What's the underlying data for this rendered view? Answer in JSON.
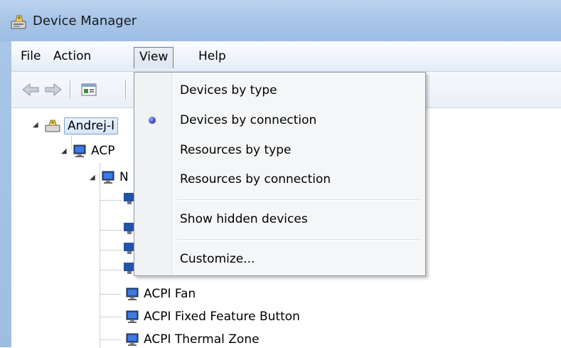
{
  "window": {
    "title": "Device Manager",
    "icon": "device-manager-icon"
  },
  "menubar": {
    "items": [
      {
        "label": "File"
      },
      {
        "label": "Action"
      },
      {
        "label": "View",
        "active": true
      },
      {
        "label": "Help"
      }
    ]
  },
  "toolbar": {
    "buttons": [
      {
        "icon": "back-arrow-icon"
      },
      {
        "icon": "forward-arrow-icon"
      },
      {
        "icon": "properties-icon"
      }
    ]
  },
  "tree": {
    "root": {
      "label": "Andrej-I"
    },
    "level1": {
      "label": "ACP"
    },
    "level2": {
      "label": "N"
    },
    "children": [
      {
        "label": "ACPI Fan"
      },
      {
        "label": "ACPI Fixed Feature Button"
      },
      {
        "label": "ACPI Thermal Zone"
      }
    ]
  },
  "view_menu": {
    "items": [
      {
        "label": "Devices by type",
        "checked": false
      },
      {
        "label": "Devices by connection",
        "checked": true
      },
      {
        "label": "Resources by type",
        "checked": false
      },
      {
        "label": "Resources by connection",
        "checked": false
      },
      {
        "label": "Show hidden devices",
        "checked": false
      },
      {
        "label": "Customize...",
        "checked": false
      }
    ]
  }
}
